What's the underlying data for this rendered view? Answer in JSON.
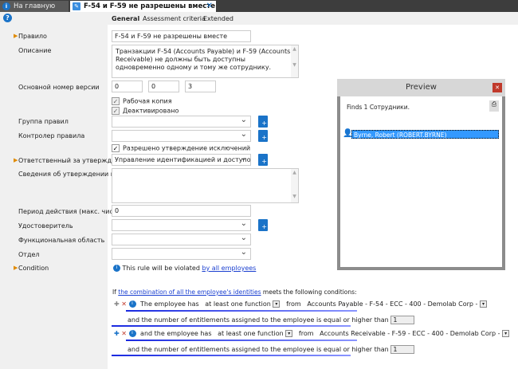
{
  "tabs": [
    {
      "label": "На главную"
    },
    {
      "label": "F-54 и F-59 не разрешены вместе"
    }
  ],
  "subtabs": [
    "General",
    "Assessment criteria",
    "Extended"
  ],
  "form": {
    "rule_label": "Правило",
    "rule_value": "F-54 и F-59 не разрешены вместе",
    "desc_label": "Описание",
    "desc_value": "Транзакции F-54 (Accounts Payable) и F-59 (Accounts Receivable) не должны быть доступны одновременно одному и тому же сотруднику.",
    "version_label": "Основной номер версии",
    "version": [
      "0",
      "0",
      "3"
    ],
    "working_copy": "Рабочая копия",
    "deactivated": "Деактивировано",
    "group_label": "Группа правил",
    "controller_label": "Контролер правила",
    "exceptions_allowed": "Разрешено утверждение исключений",
    "approver_label": "Ответственный за утверждение...",
    "approver_value": "Управление идентификацией и доступом\\Ау",
    "exc_info_label": "Сведения об утверждении искл...",
    "period_label": "Период действия (макс. число...",
    "period_value": "0",
    "certifier_label": "Удостоверитель",
    "func_area_label": "Функциональная область",
    "dept_label": "Отдел",
    "condition_label": "Condition",
    "violated_text": "This rule will be violated ",
    "violated_link": "by all employees"
  },
  "conditions": {
    "if": "If ",
    "if_link": "the combination of all the employee's identities",
    "if_tail": " meets the following conditions:",
    "rows": [
      {
        "lead": "The employee has",
        "mode": "at least one function",
        "from": "from",
        "target": "Accounts Payable - F-54 - ECC - 400 - Demolab Corp -",
        "count_text": "and the number of entitlements assigned to the employee is equal or higher than",
        "count": "1"
      },
      {
        "lead": "and the employee has",
        "mode": "at least one function",
        "from": "from",
        "target": "Accounts Receivable - F-59 - ECC - 400 - Demolab Corp -",
        "count_text": "and the number of entitlements assigned to the employee is equal or higher than",
        "count": "1"
      }
    ]
  },
  "preview": {
    "title": "Preview",
    "finds": "Finds 1 Сотрудники.",
    "result": "Byrne, Robert (ROBERT.BYRNE)"
  }
}
